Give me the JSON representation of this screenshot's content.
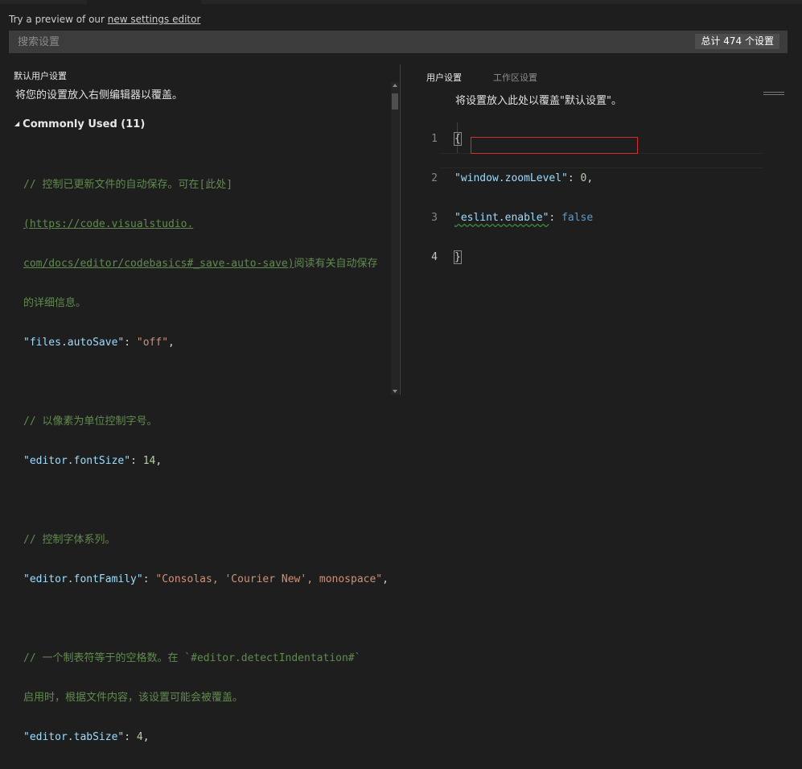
{
  "preview_banner": {
    "text": "Try a preview of our ",
    "link": "new settings editor"
  },
  "search": {
    "placeholder": "搜索设置",
    "count_label": "总计 474 个设置"
  },
  "default_settings": {
    "title": "默认用户设置",
    "hint": "将您的设置放入右侧编辑器以覆盖。",
    "group_header": "Commonly Used (11)",
    "autosave": {
      "comment_1": "// 控制已更新文件的自动保存。可在[此处]",
      "link_1": "(https://code.visualstudio.",
      "link_2": "com/docs/editor/codebasics#_save-auto-save)",
      "comment_2": "阅读有关自动保存",
      "comment_3": "的详细信息。",
      "key": "\"files.autoSave\"",
      "value": "\"off\""
    },
    "font_size": {
      "comment": "// 以像素为单位控制字号。",
      "key": "\"editor.fontSize\"",
      "value": "14"
    },
    "font_family": {
      "comment": "// 控制字体系列。",
      "key": "\"editor.fontFamily\"",
      "value": "\"Consolas, 'Courier New', monospace\""
    },
    "tab_size": {
      "comment_1": "// 一个制表符等于的空格数。在 `#editor.detectIndentation#`",
      "comment_2": "启用时，根据文件内容，该设置可能会被覆盖。",
      "key": "\"editor.tabSize\"",
      "value": "4"
    }
  },
  "user_settings": {
    "tabs": [
      "用户设置",
      "工作区设置"
    ],
    "hint": "将设置放入此处以覆盖\"默认设置\"。",
    "line_numbers": [
      "1",
      "2",
      "3",
      "4"
    ],
    "open_brace": "{",
    "close_brace": "}",
    "lines": [
      {
        "key": "\"window.zoomLevel\"",
        "value": "0",
        "trailing": ","
      },
      {
        "key": "\"eslint.enable\"",
        "value": "false",
        "trailing": ""
      }
    ]
  }
}
